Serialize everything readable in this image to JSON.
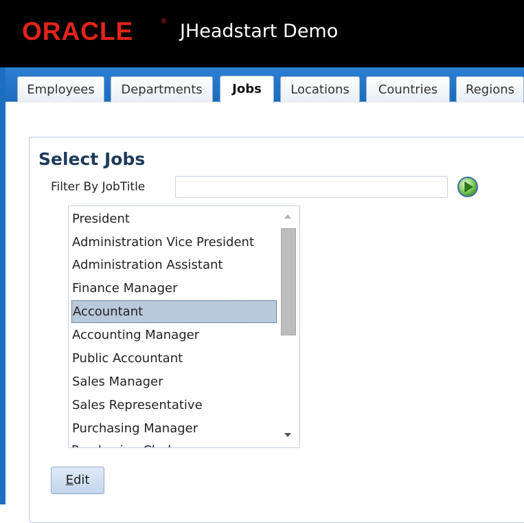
{
  "header": {
    "logo_text": "ORACLE",
    "logo_mark": "®",
    "app_title": "JHeadstart Demo",
    "logo_color": "#e3241b"
  },
  "tabs": [
    {
      "label": "Employees",
      "active": false
    },
    {
      "label": "Departments",
      "active": false
    },
    {
      "label": "Jobs",
      "active": true
    },
    {
      "label": "Locations",
      "active": false
    },
    {
      "label": "Countries",
      "active": false
    },
    {
      "label": "Regions",
      "active": false
    }
  ],
  "panel": {
    "title": "Select Jobs",
    "filter_label": "Filter By JobTitle",
    "filter_value": "",
    "go_icon": "go-arrow-icon"
  },
  "jobs_list": {
    "items": [
      "President",
      "Administration Vice President",
      "Administration Assistant",
      "Finance Manager",
      "Accountant",
      "Accounting Manager",
      "Public Accountant",
      "Sales Manager",
      "Sales Representative",
      "Purchasing Manager"
    ],
    "partial_item": "Purchasing Clerk",
    "selected": "Accountant"
  },
  "actions": {
    "edit_access_key": "E",
    "edit_rest": "dit"
  },
  "colors": {
    "frame_blue": "#1b6fc3",
    "selection": "#b9c9dc",
    "title_color": "#1f3a5a"
  }
}
